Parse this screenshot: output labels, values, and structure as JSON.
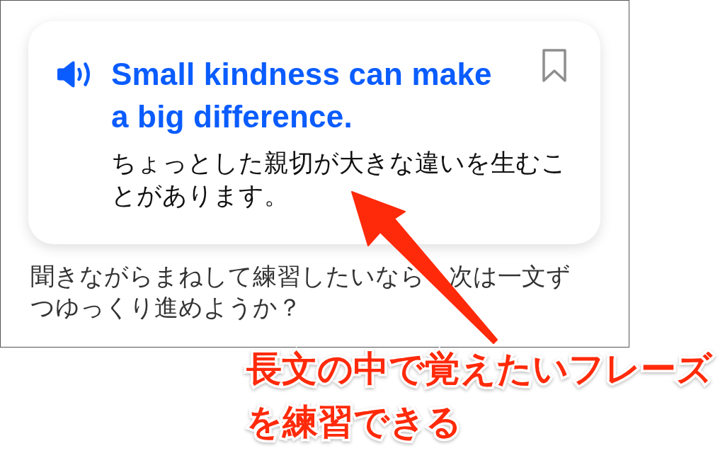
{
  "phrase_card": {
    "english": "Small kindness can make a big difference.",
    "japanese": "ちょっとした親切が大きな違いを生むことがあります。",
    "bookmarked": false
  },
  "message": "聞きながらまねして練習したいなら　次は一文ずつゆっくり進めようか？",
  "annotation": {
    "text": "長文の中で覚えたいフレーズを練習できる"
  }
}
